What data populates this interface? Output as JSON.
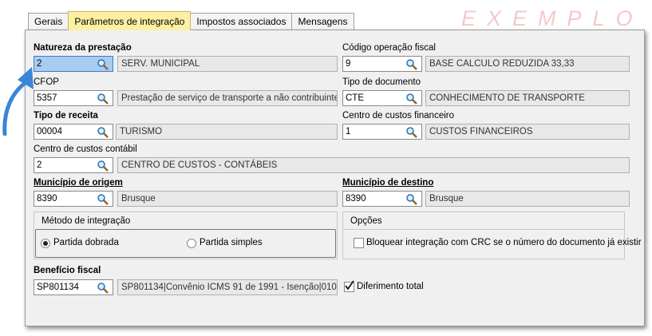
{
  "tabs": [
    "Gerais",
    "Parâmetros de integração",
    "Impostos associados",
    "Mensagens"
  ],
  "active_tab": "Parâmetros de integração",
  "watermark": "EXEMPLO",
  "fields": {
    "natureza": {
      "label": "Natureza da prestação",
      "code": "2",
      "desc": "SERV. MUNICIPAL"
    },
    "cod_oper": {
      "label": "Código operação fiscal",
      "code": "9",
      "desc": "BASE CALCULO REDUZIDA 33,33"
    },
    "cfop": {
      "label": "CFOP",
      "code": "5357",
      "desc": "Prestação de serviço de transporte a não contribuinte"
    },
    "tipo_doc": {
      "label": "Tipo de documento",
      "code": "CTE",
      "desc": "CONHECIMENTO DE TRANSPORTE"
    },
    "tipo_receita": {
      "label": "Tipo de receita",
      "code": "00004",
      "desc": "TURISMO"
    },
    "cc_fin": {
      "label": "Centro de custos financeiro",
      "code": "1",
      "desc": "CUSTOS FINANCEIROS"
    },
    "cc_cont": {
      "label": "Centro de custos contábil",
      "code": "2",
      "desc": "CENTRO DE CUSTOS - CONTÁBEIS"
    },
    "mun_origem": {
      "label": "Município de origem",
      "code": "8390",
      "desc": "Brusque"
    },
    "mun_destino": {
      "label": "Município de destino",
      "code": "8390",
      "desc": "Brusque"
    },
    "beneficio": {
      "label": "Benefício fiscal",
      "code": "SP801134",
      "desc": "SP801134|Convênio ICMS 91 de 1991 - Isenção|010..."
    }
  },
  "metodo": {
    "title": "Método de integração",
    "opt1": "Partida dobrada",
    "opt2": "Partida simples",
    "selected": "Partida dobrada"
  },
  "opcoes": {
    "title": "Opções",
    "bloquear": "Bloquear integração com CRC se o número do documento já existir",
    "bloquear_checked": false
  },
  "diferimento": {
    "label": "Diferimento total",
    "checked": true
  }
}
